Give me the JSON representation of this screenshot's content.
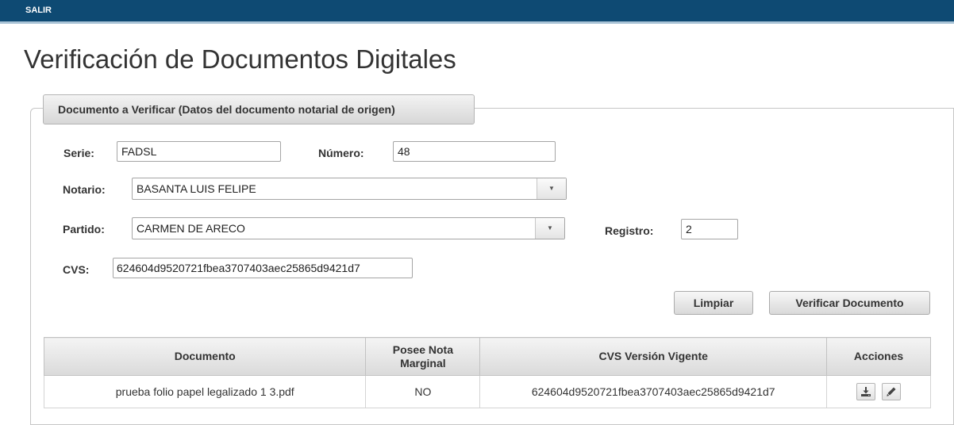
{
  "header": {
    "salir_label": "SALIR"
  },
  "page": {
    "title": "Verificación de Documentos Digitales"
  },
  "form": {
    "legend": "Documento a Verificar (Datos del documento notarial de origen)",
    "serie": {
      "label": "Serie:",
      "value": "FADSL"
    },
    "numero": {
      "label": "Número:",
      "value": "48"
    },
    "notario": {
      "label": "Notario:",
      "value": "BASANTA LUIS FELIPE"
    },
    "partido": {
      "label": "Partido:",
      "value": "CARMEN DE ARECO"
    },
    "registro": {
      "label": "Registro:",
      "value": "2"
    },
    "cvs": {
      "label": "CVS:",
      "value": "624604d9520721fbea3707403aec25865d9421d7"
    },
    "buttons": {
      "limpiar": "Limpiar",
      "verificar": "Verificar Documento"
    }
  },
  "table": {
    "headers": {
      "documento": "Documento",
      "nota_line1": "Posee Nota",
      "nota_line2": "Marginal",
      "cvs": "CVS Versión Vigente",
      "acciones": "Acciones"
    },
    "rows": [
      {
        "documento": "prueba folio papel legalizado 1 3.pdf",
        "nota": "NO",
        "cvs": "624604d9520721fbea3707403aec25865d9421d7",
        "actions": [
          "download-icon",
          "pencil-icon"
        ]
      }
    ]
  },
  "colors": {
    "header_bar": "#0e4a73",
    "header_accent": "#a9c3d6"
  }
}
